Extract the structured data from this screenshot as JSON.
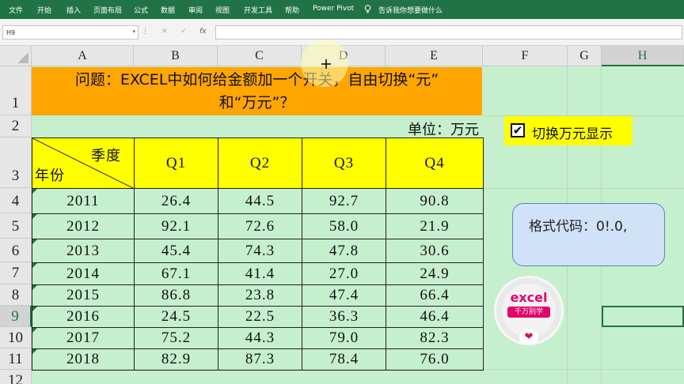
{
  "ribbon": {
    "tabs": [
      "文件",
      "开始",
      "插入",
      "页面布局",
      "公式",
      "数据",
      "审阅",
      "视图",
      "开发工具",
      "帮助",
      "Power Pivot"
    ],
    "tell_me": "告诉我你想要做什么",
    "tell_me_icon": "lightbulb-icon"
  },
  "formula_bar": {
    "name_box": "H9",
    "cancel": "✕",
    "enter": "✓",
    "fx": "fx",
    "formula": ""
  },
  "columns": [
    "A",
    "B",
    "C",
    "D",
    "E",
    "F",
    "G",
    "H"
  ],
  "selected_column": "H",
  "rows": [
    "1",
    "2",
    "3",
    "4",
    "5",
    "6",
    "7",
    "8",
    "9",
    "10",
    "11",
    "12"
  ],
  "selected_row": "9",
  "sheet": {
    "title_line1": "问题：EXCEL中如何给金额加一个开关，自由切换“元”",
    "title_line2": "和“万元”？",
    "unit": "单位：万元",
    "header_season": "季度",
    "header_year": "年份",
    "quarters": [
      "Q1",
      "Q2",
      "Q3",
      "Q4"
    ],
    "data": [
      {
        "year": "2011",
        "q1": "26.4",
        "q2": "44.5",
        "q3": "92.7",
        "q4": "90.8"
      },
      {
        "year": "2012",
        "q1": "92.1",
        "q2": "72.6",
        "q3": "58.0",
        "q4": "21.9"
      },
      {
        "year": "2013",
        "q1": "45.4",
        "q2": "74.3",
        "q3": "47.8",
        "q4": "30.6"
      },
      {
        "year": "2014",
        "q1": "67.1",
        "q2": "41.4",
        "q3": "27.0",
        "q4": "24.9"
      },
      {
        "year": "2015",
        "q1": "86.8",
        "q2": "23.8",
        "q3": "47.4",
        "q4": "66.4"
      },
      {
        "year": "2016",
        "q1": "24.5",
        "q2": "22.5",
        "q3": "36.3",
        "q4": "46.4"
      },
      {
        "year": "2017",
        "q1": "75.2",
        "q2": "44.3",
        "q3": "79.0",
        "q4": "82.3"
      },
      {
        "year": "2018",
        "q1": "82.9",
        "q2": "87.3",
        "q3": "78.4",
        "q4": "76.0"
      }
    ]
  },
  "checkbox": {
    "label": "切换万元显示",
    "checked": true,
    "mark": "✔"
  },
  "format_callout": {
    "text": "格式代码：0!.0,"
  },
  "logo": {
    "line1": "excel",
    "line2": "千万别学",
    "heart": "❤"
  },
  "colors": {
    "excel_green": "#217346",
    "title_bg": "#ffa500",
    "header_bg": "#ffff00",
    "sheet_bg": "#c6efce",
    "callout_bg": "#cfe2f8",
    "logo_accent": "#e5006a"
  }
}
